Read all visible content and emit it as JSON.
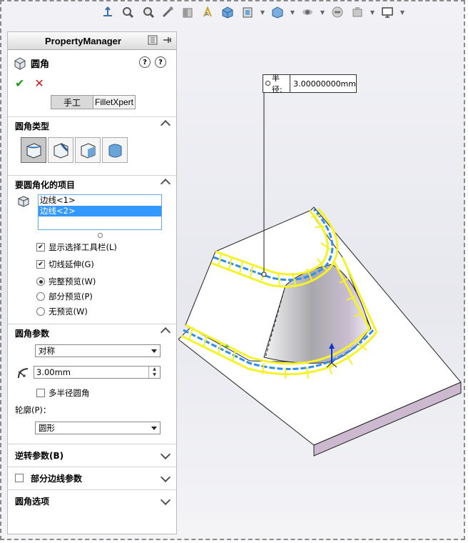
{
  "toolbar": {
    "icons": [
      "view-normal-icon",
      "zoom-fit-icon",
      "zoom-area-icon",
      "previous-view-icon",
      "section-view-icon",
      "dynamic-annotation-icon",
      "view-orientation-icon",
      "display-style-icon",
      "hide-show-icon",
      "edit-appearance-icon",
      "apply-scene-icon",
      "view-settings-icon"
    ]
  },
  "pm": {
    "title": "PropertyManager",
    "feature_title": "圆角",
    "mode_manual": "手工",
    "mode_filletxpert": "FilletXpert",
    "sections": {
      "fillet_type": "圆角类型",
      "items": "要圆角化的项目",
      "params": "圆角参数",
      "setback": "逆转参数(B)",
      "partial_edge": "部分边线参数",
      "options": "圆角选项"
    },
    "edges": [
      "边线<1>",
      "边线<2>"
    ],
    "checks": {
      "show_toolbar": "显示选择工具栏(L)",
      "tangent": "切线延伸(G)",
      "multi_radius": "多半径圆角"
    },
    "preview": {
      "full": "完整预览(W)",
      "partial": "部分预览(P)",
      "none": "无预览(W)"
    },
    "symmetric": "对称",
    "radius": "3.00mm",
    "profile_label": "轮廓(P)：",
    "profile": "圆形"
  },
  "callout": {
    "label": "半径:",
    "value": "3.00000000mm"
  },
  "colors": {
    "selection_yellow": "#f5f22a",
    "edge_blue": "#2f8fe6",
    "list_select": "#3399ff"
  }
}
